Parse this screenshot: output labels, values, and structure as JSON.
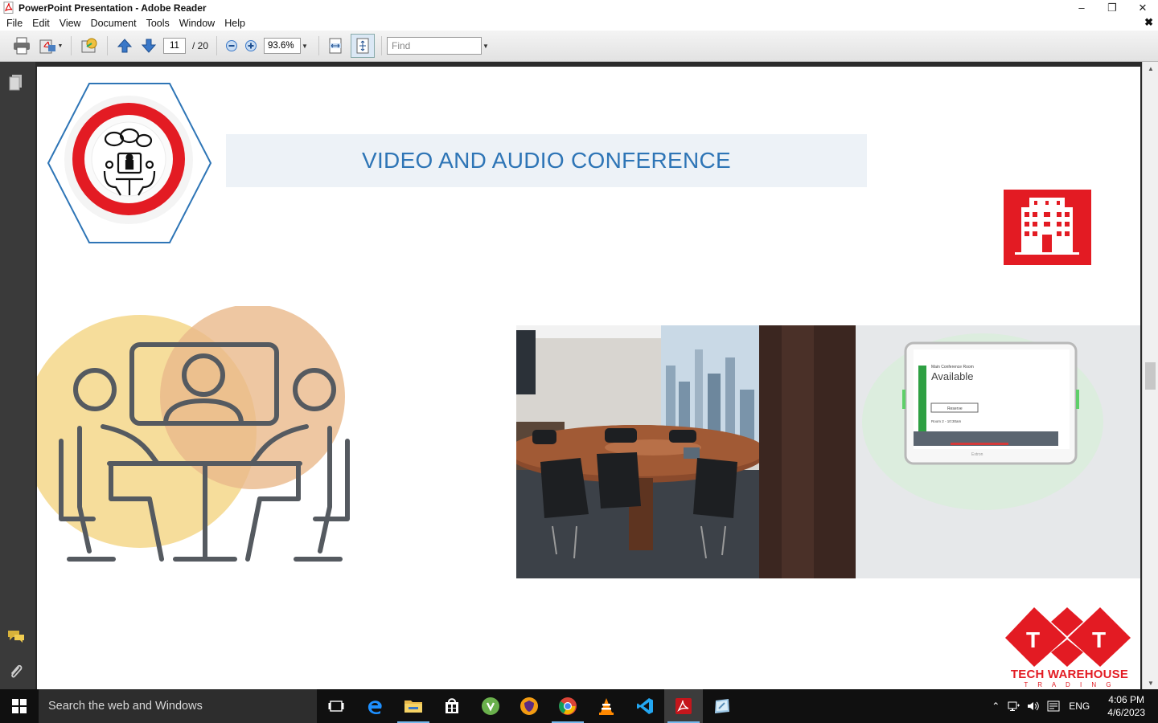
{
  "window": {
    "title": "PowerPoint Presentation - Adobe Reader",
    "minimize": "–",
    "restore": "❐",
    "close": "✕"
  },
  "menu": {
    "items": [
      "File",
      "Edit",
      "View",
      "Document",
      "Tools",
      "Window",
      "Help"
    ],
    "doc_close": "✖"
  },
  "toolbar": {
    "current_page": "11",
    "page_separator": "/ 20",
    "zoom": "93.6%",
    "find_placeholder": "Find"
  },
  "slide": {
    "title": "VIDEO AND AUDIO CONFERENCE",
    "logo_line1": "TECH WAREHOUSE",
    "logo_line2": "T R A D I N G",
    "logo_letters": [
      "T",
      "T"
    ],
    "panel_text": {
      "room": "Main Conference Room",
      "status": "Available",
      "button": "Reserve",
      "meeting": "Room 2 - 10:30am",
      "brand": "Extron"
    }
  },
  "colors": {
    "title_blue": "#2e75b6",
    "brand_red": "#e31b23",
    "hexagon_blue": "#2e75b6",
    "circle_yellow": "#f5d78a",
    "circle_orange": "#eab98b"
  },
  "taskbar": {
    "search_text": "Search the web and Windows",
    "language": "ENG",
    "time": "4:06 PM",
    "date": "4/6/2023"
  }
}
